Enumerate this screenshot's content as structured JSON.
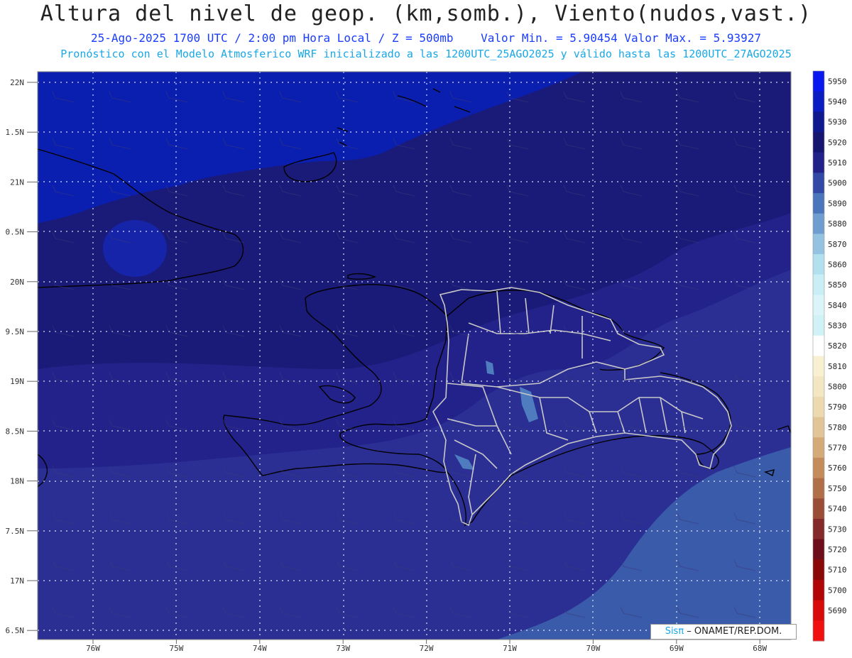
{
  "header": {
    "title": "Altura del nivel de geop. (km,somb.), Viento(nudos,vast.)",
    "subtitle_left": "25-Ago-2025  1700 UTC / 2:00 pm Hora Local / Z = 500mb",
    "subtitle_right": "Valor Min. = 5.90454  Valor Max. = 5.93927",
    "run_info": "Pronóstico con el Modelo Atmosferico WRF inicializado a las 1200UTC_25AGO2025 y válido hasta las  1200UTC_27AGO2025"
  },
  "map": {
    "lat_labels": [
      "22N",
      "1.5N",
      "21N",
      "0.5N",
      "20N",
      "9.5N",
      "19N",
      "8.5N",
      "18N",
      "7.5N",
      "17N",
      "6.5N"
    ],
    "lon_labels": [
      "76W",
      "75W",
      "74W",
      "73W",
      "72W",
      "71W",
      "70W",
      "69W",
      "68W"
    ],
    "grid": true,
    "field_colors": {
      "c5930": "#1a1a78",
      "c5920": "#22228a",
      "c5910": "#2b2f94",
      "c5900": "#3a5aaa",
      "c5890": "#4f7cbf",
      "c5940": "#0a1fb0"
    }
  },
  "colorbar": {
    "levels": [
      "5950",
      "5940",
      "5930",
      "5920",
      "5910",
      "5900",
      "5890",
      "5880",
      "5870",
      "5860",
      "5850",
      "5840",
      "5830",
      "5820",
      "5810",
      "5800",
      "5790",
      "5780",
      "5770",
      "5760",
      "5750",
      "5740",
      "5730",
      "5720",
      "5710",
      "5700",
      "5690"
    ],
    "colors": [
      "#0a18f0",
      "#0b1cc0",
      "#101890",
      "#161670",
      "#22228a",
      "#324aa6",
      "#4a76bb",
      "#6f9dcf",
      "#93c3e0",
      "#b3e0ee",
      "#c9eef5",
      "#daf4f8",
      "#d0f1f6",
      "#ffffff",
      "#f8f0d0",
      "#f2e6c3",
      "#ecd9b0",
      "#e2c596",
      "#d4aa78",
      "#c38c5a",
      "#b06f48",
      "#9a4e38",
      "#842a2a",
      "#6e0e1a",
      "#8a0808",
      "#b00606",
      "#d80a0a",
      "#f01010"
    ]
  },
  "credit": {
    "logo": "Sisπ",
    "org": " – ONAMET/REP.DOM."
  }
}
